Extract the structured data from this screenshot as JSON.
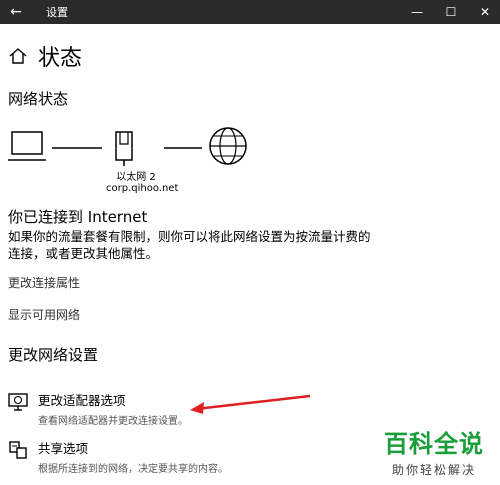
{
  "window": {
    "title": "设置",
    "back_icon": "←",
    "minimize_icon": "—",
    "maximize_icon": "☐",
    "close_icon": "✕"
  },
  "page": {
    "title": "状态"
  },
  "network_status": {
    "heading": "网络状态",
    "adapter_name": "以太网 2",
    "network_domain": "corp.qihoo.net"
  },
  "connection": {
    "title": "你已连接到 Internet",
    "description": "如果你的流量套餐有限制，则你可以将此网络设置为按流量计费的连接，或者更改其他属性。"
  },
  "links": {
    "change_properties": "更改连接属性",
    "show_networks": "显示可用网络"
  },
  "change_settings": {
    "heading": "更改网络设置",
    "options": [
      {
        "title": "更改适配器选项",
        "desc": "查看网络适配器并更改连接设置。",
        "icon": "adapter-icon"
      },
      {
        "title": "共享选项",
        "desc": "根据所连接到的网络，决定要共享的内容。",
        "icon": "sharing-icon"
      }
    ]
  },
  "watermark": {
    "main": "百科全说",
    "sub": "助你轻松解决"
  },
  "colors": {
    "titlebar": "#2b2b2b",
    "annotation_arrow": "#e02020",
    "watermark_green": "#1a9e3a"
  }
}
